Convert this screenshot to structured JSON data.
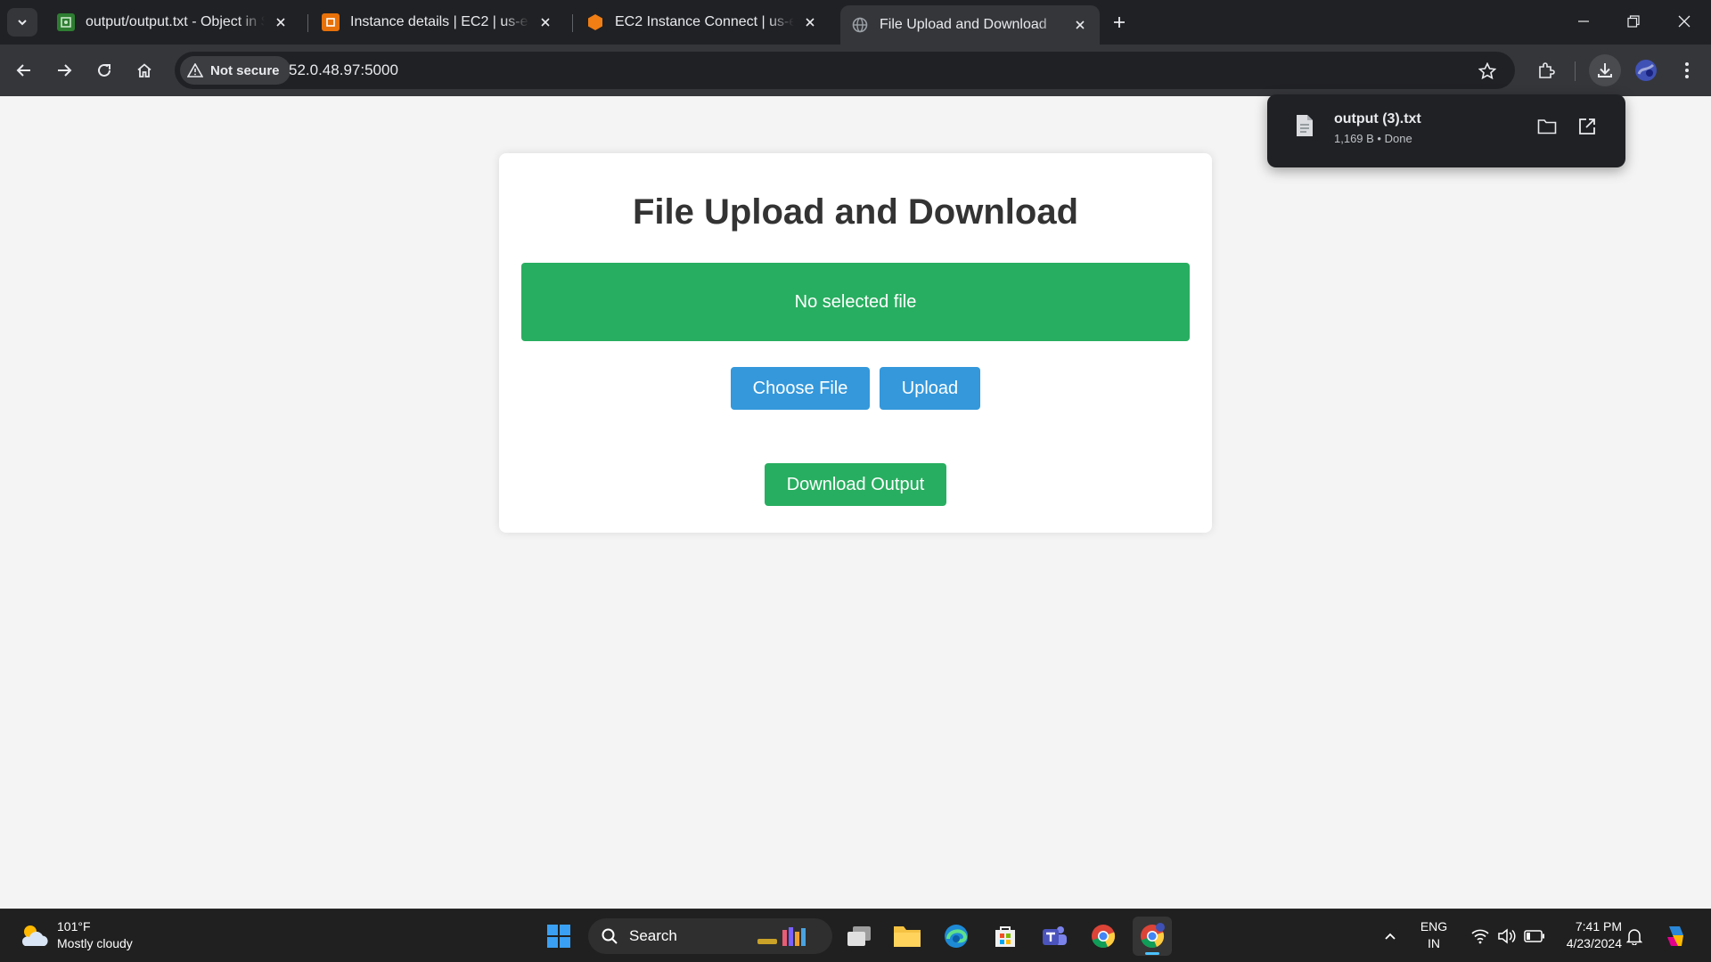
{
  "browser": {
    "tabs": [
      {
        "title": "output/output.txt - Object in S3"
      },
      {
        "title": "Instance details | EC2 | us-east-1"
      },
      {
        "title": "EC2 Instance Connect | us-east-1"
      },
      {
        "title": "File Upload and Download"
      }
    ],
    "security_label": "Not secure",
    "url": "52.0.48.97:5000"
  },
  "download": {
    "file_name": "output (3).txt",
    "status": "1,169 B • Done"
  },
  "page": {
    "heading": "File Upload and Download",
    "flash_message": "No selected file",
    "choose_file_label": "Choose File",
    "upload_label": "Upload",
    "download_label": "Download Output"
  },
  "taskbar": {
    "temperature": "101°F",
    "weather_condition": "Mostly cloudy",
    "search_label": "Search",
    "language": "ENG",
    "region": "IN",
    "time": "7:41 PM",
    "date": "4/23/2024"
  },
  "colors": {
    "success_green": "#28ae60",
    "button_blue": "#3498db",
    "heading_text": "#333333",
    "page_background": "#f4f4f4"
  }
}
